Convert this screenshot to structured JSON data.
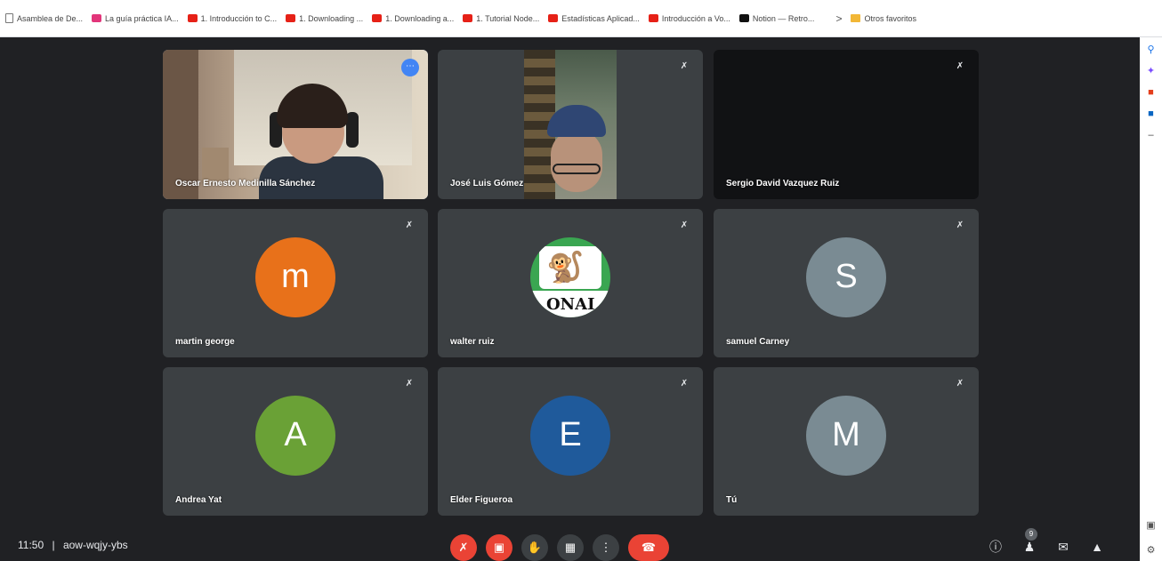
{
  "bookmarks": [
    {
      "label": "Asamblea de De...",
      "icon": "page-icon"
    },
    {
      "label": "La guía práctica IA...",
      "icon": "pink-icon"
    },
    {
      "label": "1. Introducción to C...",
      "icon": "youtube-icon"
    },
    {
      "label": "1. Downloading ...",
      "icon": "youtube-icon"
    },
    {
      "label": "1. Downloading a...",
      "icon": "youtube-icon"
    },
    {
      "label": "1. Tutorial Node...",
      "icon": "youtube-icon"
    },
    {
      "label": "Estadísticas Aplicad...",
      "icon": "youtube-icon"
    },
    {
      "label": "Introducción a Vo...",
      "icon": "youtube-icon"
    },
    {
      "label": "Notion — Retro...",
      "icon": "black-icon"
    },
    {
      "label": "Otros favoritos",
      "icon": "folder-icon"
    }
  ],
  "bookmarks_more": ">",
  "participants": [
    {
      "name": "Oscar Ernesto Medinilla Sánchez",
      "type": "video"
    },
    {
      "name": "José Luis Gómez",
      "type": "video"
    },
    {
      "name": "Sergio David Vazquez Ruiz",
      "type": "dark"
    },
    {
      "name": "martin george",
      "type": "avatar",
      "initial": "m",
      "color": "#e8711a"
    },
    {
      "name": "walter ruiz",
      "type": "logo",
      "logo_text": "ONAI"
    },
    {
      "name": "samuel Carney",
      "type": "avatar",
      "initial": "S",
      "color": "#7a8b93"
    },
    {
      "name": "Andrea Yat",
      "type": "avatar",
      "initial": "A",
      "color": "#6aa136"
    },
    {
      "name": "Elder Figueroa",
      "type": "avatar",
      "initial": "E",
      "color": "#1f5a9b"
    },
    {
      "name": "Tú",
      "type": "avatar",
      "initial": "M",
      "color": "#7a8b93"
    }
  ],
  "meeting": {
    "time": "11:50",
    "separator": "|",
    "code": "aow-wqjy-ybs"
  },
  "participants_count": "9"
}
